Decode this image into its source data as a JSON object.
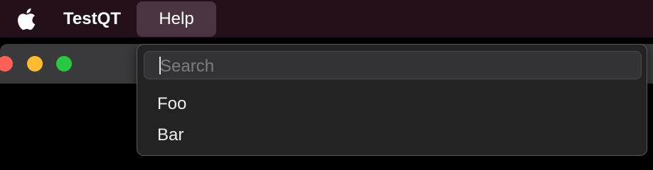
{
  "menubar": {
    "apple_icon": "apple-logo-icon",
    "app_name": "TestQT",
    "help_menu_label": "Help"
  },
  "window": {
    "traffic_lights": [
      "close",
      "minimize",
      "maximize"
    ],
    "colors": {
      "close": "#fe5f57",
      "minimize": "#febc2e",
      "maximize": "#28c840"
    }
  },
  "help_menu": {
    "search_placeholder": "Search",
    "items": [
      {
        "label": "Foo"
      },
      {
        "label": "Bar"
      }
    ]
  }
}
